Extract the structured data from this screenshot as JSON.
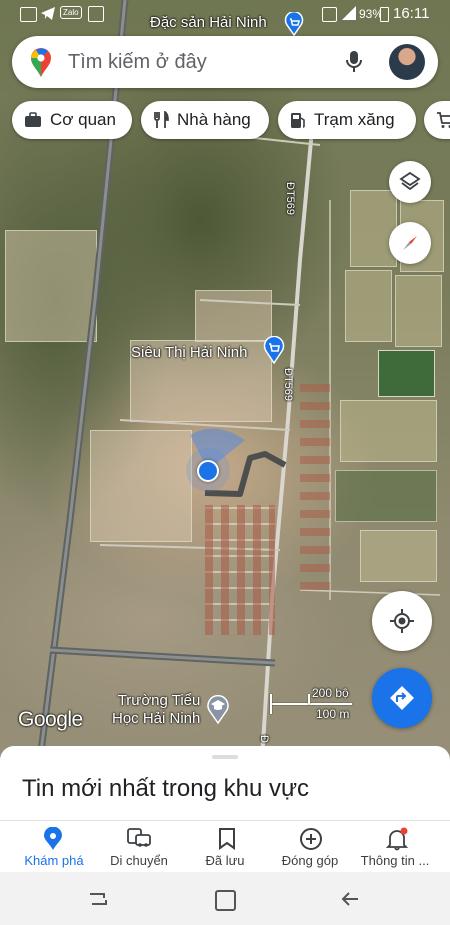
{
  "search": {
    "placeholder": "Tìm kiếm ở đây"
  },
  "chips": [
    {
      "label": "Cơ quan",
      "icon": "briefcase-icon"
    },
    {
      "label": "Nhà hàng",
      "icon": "restaurant-icon"
    },
    {
      "label": "Trạm xăng",
      "icon": "gas-station-icon"
    }
  ],
  "status": {
    "battery": "93%",
    "time": "16:11",
    "app_label": "Zalo"
  },
  "map": {
    "labels": {
      "top_place": "Đặc sản Hải Ninh",
      "market": "Siêu Thị Hải Ninh",
      "school_line1": "Trường Tiểu",
      "school_line2": "Học Hải Ninh",
      "road1": "ĐT569",
      "road2": "ĐT569",
      "road3": "Đ"
    },
    "scale": {
      "top": "200 bộ",
      "bottom": "100 m"
    },
    "watermark": "Google"
  },
  "sheet": {
    "title": "Tin mới nhất trong khu vực"
  },
  "nav": [
    {
      "label": "Khám phá",
      "icon": "explore-pin-icon",
      "active": true
    },
    {
      "label": "Di chuyển",
      "icon": "commute-icon",
      "active": false
    },
    {
      "label": "Đã lưu",
      "icon": "bookmark-icon",
      "active": false
    },
    {
      "label": "Đóng góp",
      "icon": "add-circle-icon",
      "active": false
    },
    {
      "label": "Thông tin ...",
      "icon": "bell-icon",
      "active": false
    }
  ],
  "colors": {
    "accent": "#1a73e8",
    "location_dot": "#1a73e8",
    "notification": "#ea4335"
  }
}
